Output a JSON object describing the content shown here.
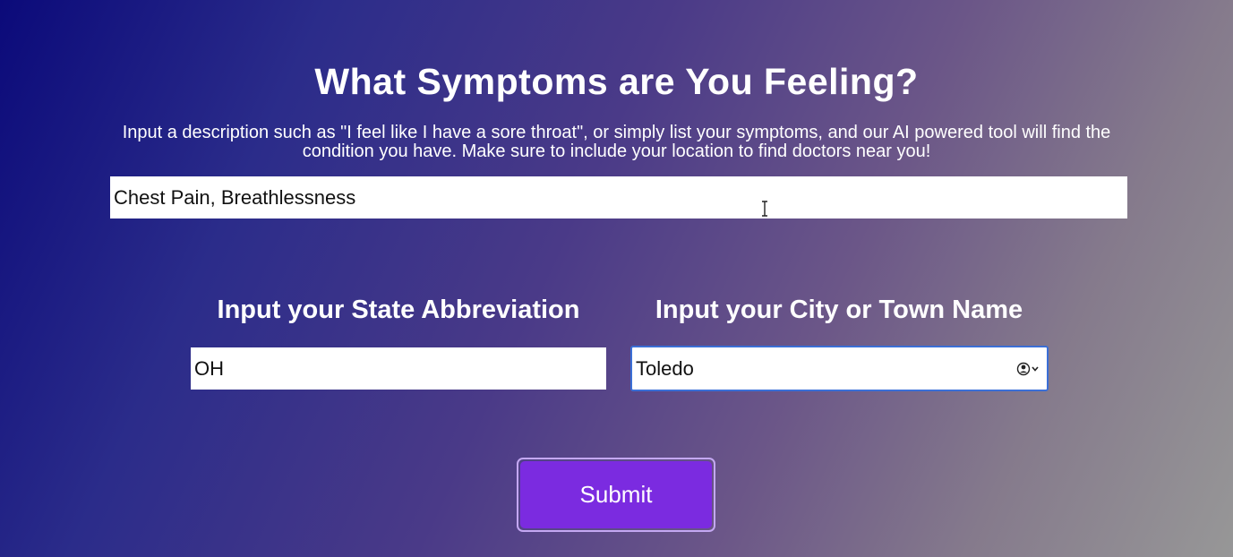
{
  "header": {
    "title": "What Symptoms are You Feeling?",
    "description": "Input a description such as \"I feel like I have a sore throat\", or simply list your symptoms, and our AI powered tool will find the condition you have. Make sure to include your location to find doctors near you!"
  },
  "symptoms": {
    "value": "Chest Pain, Breathlessness"
  },
  "state": {
    "label": "Input your State Abbreviation",
    "value": "OH"
  },
  "city": {
    "label": "Input your City or Town Name",
    "value": "Toledo"
  },
  "submit": {
    "label": "Submit"
  },
  "colors": {
    "submit_bg": "#7b2be0",
    "submit_border": "#c4a8f2",
    "focus_border": "#3b6fd6",
    "gradient_start": "#0b0a7a",
    "gradient_end": "#979797"
  },
  "icons": {
    "text_cursor": "text-cursor-icon",
    "autofill": "contact-autofill-icon"
  }
}
